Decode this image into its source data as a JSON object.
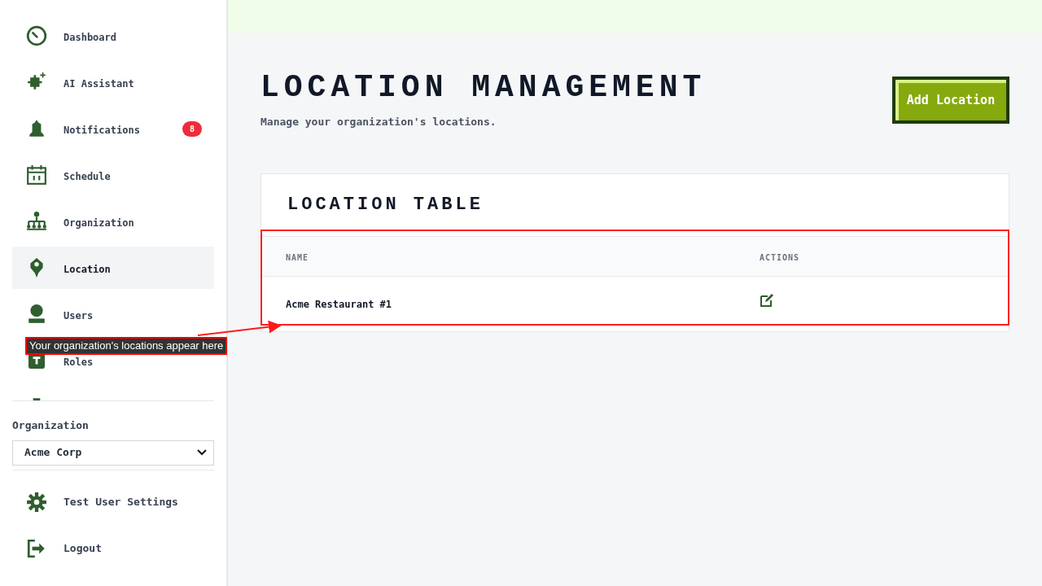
{
  "sidebar": {
    "nav_items": [
      {
        "label": "Dashboard",
        "selected": false
      },
      {
        "label": "AI Assistant",
        "selected": false
      },
      {
        "label": "Notifications",
        "selected": false,
        "badge": "8"
      },
      {
        "label": "Schedule",
        "selected": false
      },
      {
        "label": "Organization",
        "selected": false
      },
      {
        "label": "Location",
        "selected": true
      },
      {
        "label": "Users",
        "selected": false
      },
      {
        "label": "Roles",
        "selected": false
      }
    ],
    "organization": {
      "label": "Organization",
      "value": "Acme Corp"
    },
    "footer_items": [
      {
        "label": "Test User Settings"
      },
      {
        "label": "Logout"
      }
    ]
  },
  "page": {
    "title": "LOCATION MANAGEMENT",
    "subtitle": "Manage your organization's locations.",
    "add_button": "Add Location"
  },
  "table": {
    "title": "LOCATION TABLE",
    "columns": [
      "NAME",
      "ACTIONS"
    ],
    "rows": [
      {
        "name": "Acme Restaurant #1"
      }
    ]
  },
  "annotation": {
    "text": "Your organization's locations appear here"
  }
}
